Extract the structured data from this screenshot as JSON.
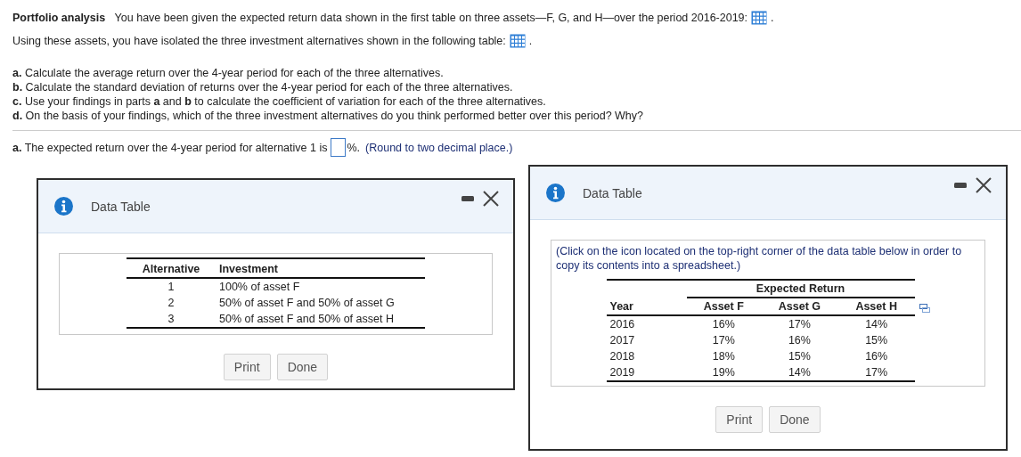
{
  "intro": [
    {
      "text": "**Portfolio analysis**   You have been given the expected return data shown in the first table on three assets—F, G, and H—over the period 2016-2019:",
      "after": "."
    },
    {
      "text": "Using these assets, you have isolated the three investment alternatives shown in the following table:",
      "after": "."
    }
  ],
  "questions": [
    "**a.** Calculate the average return over the 4-year period for each of the three alternatives.",
    "**b.** Calculate the standard deviation of returns over the 4-year period for each of the three alternatives.",
    "**c.** Use your findings in parts **a** and **b** to calculate the coefficient of variation for each of the three alternatives.",
    "**d.** On the basis of your findings, which of the three investment alternatives do you think performed better over this period?  Why?"
  ],
  "answer": {
    "prompt": "**a.** The expected return over the 4-year period for alternative 1 is",
    "unit": "%.",
    "hint": "(Round to two decimal place.)"
  },
  "dialogs": [
    {
      "kind": "alternatives",
      "title": "Data Table",
      "table": {
        "columns": [
          "Alternative",
          "Investment"
        ],
        "rows": [
          [
            "1",
            "100% of asset F"
          ],
          [
            "2",
            "50% of asset F and 50% of asset G"
          ],
          [
            "3",
            "50% of asset F and 50% of asset H"
          ]
        ]
      },
      "buttons": [
        "Print",
        "Done"
      ]
    },
    {
      "kind": "returns",
      "title": "Data Table",
      "note": "(Click on the icon located on the top-right corner of the data table below in order to copy its contents into a spreadsheet.)",
      "table": {
        "group_header": "Expected Return",
        "columns": [
          "Year",
          "Asset F",
          "Asset G",
          "Asset H"
        ],
        "rows": [
          [
            "2016",
            "16%",
            "17%",
            "14%"
          ],
          [
            "2017",
            "17%",
            "16%",
            "15%"
          ],
          [
            "2018",
            "18%",
            "15%",
            "16%"
          ],
          [
            "2019",
            "19%",
            "14%",
            "17%"
          ]
        ]
      },
      "buttons": [
        "Print",
        "Done"
      ]
    }
  ]
}
